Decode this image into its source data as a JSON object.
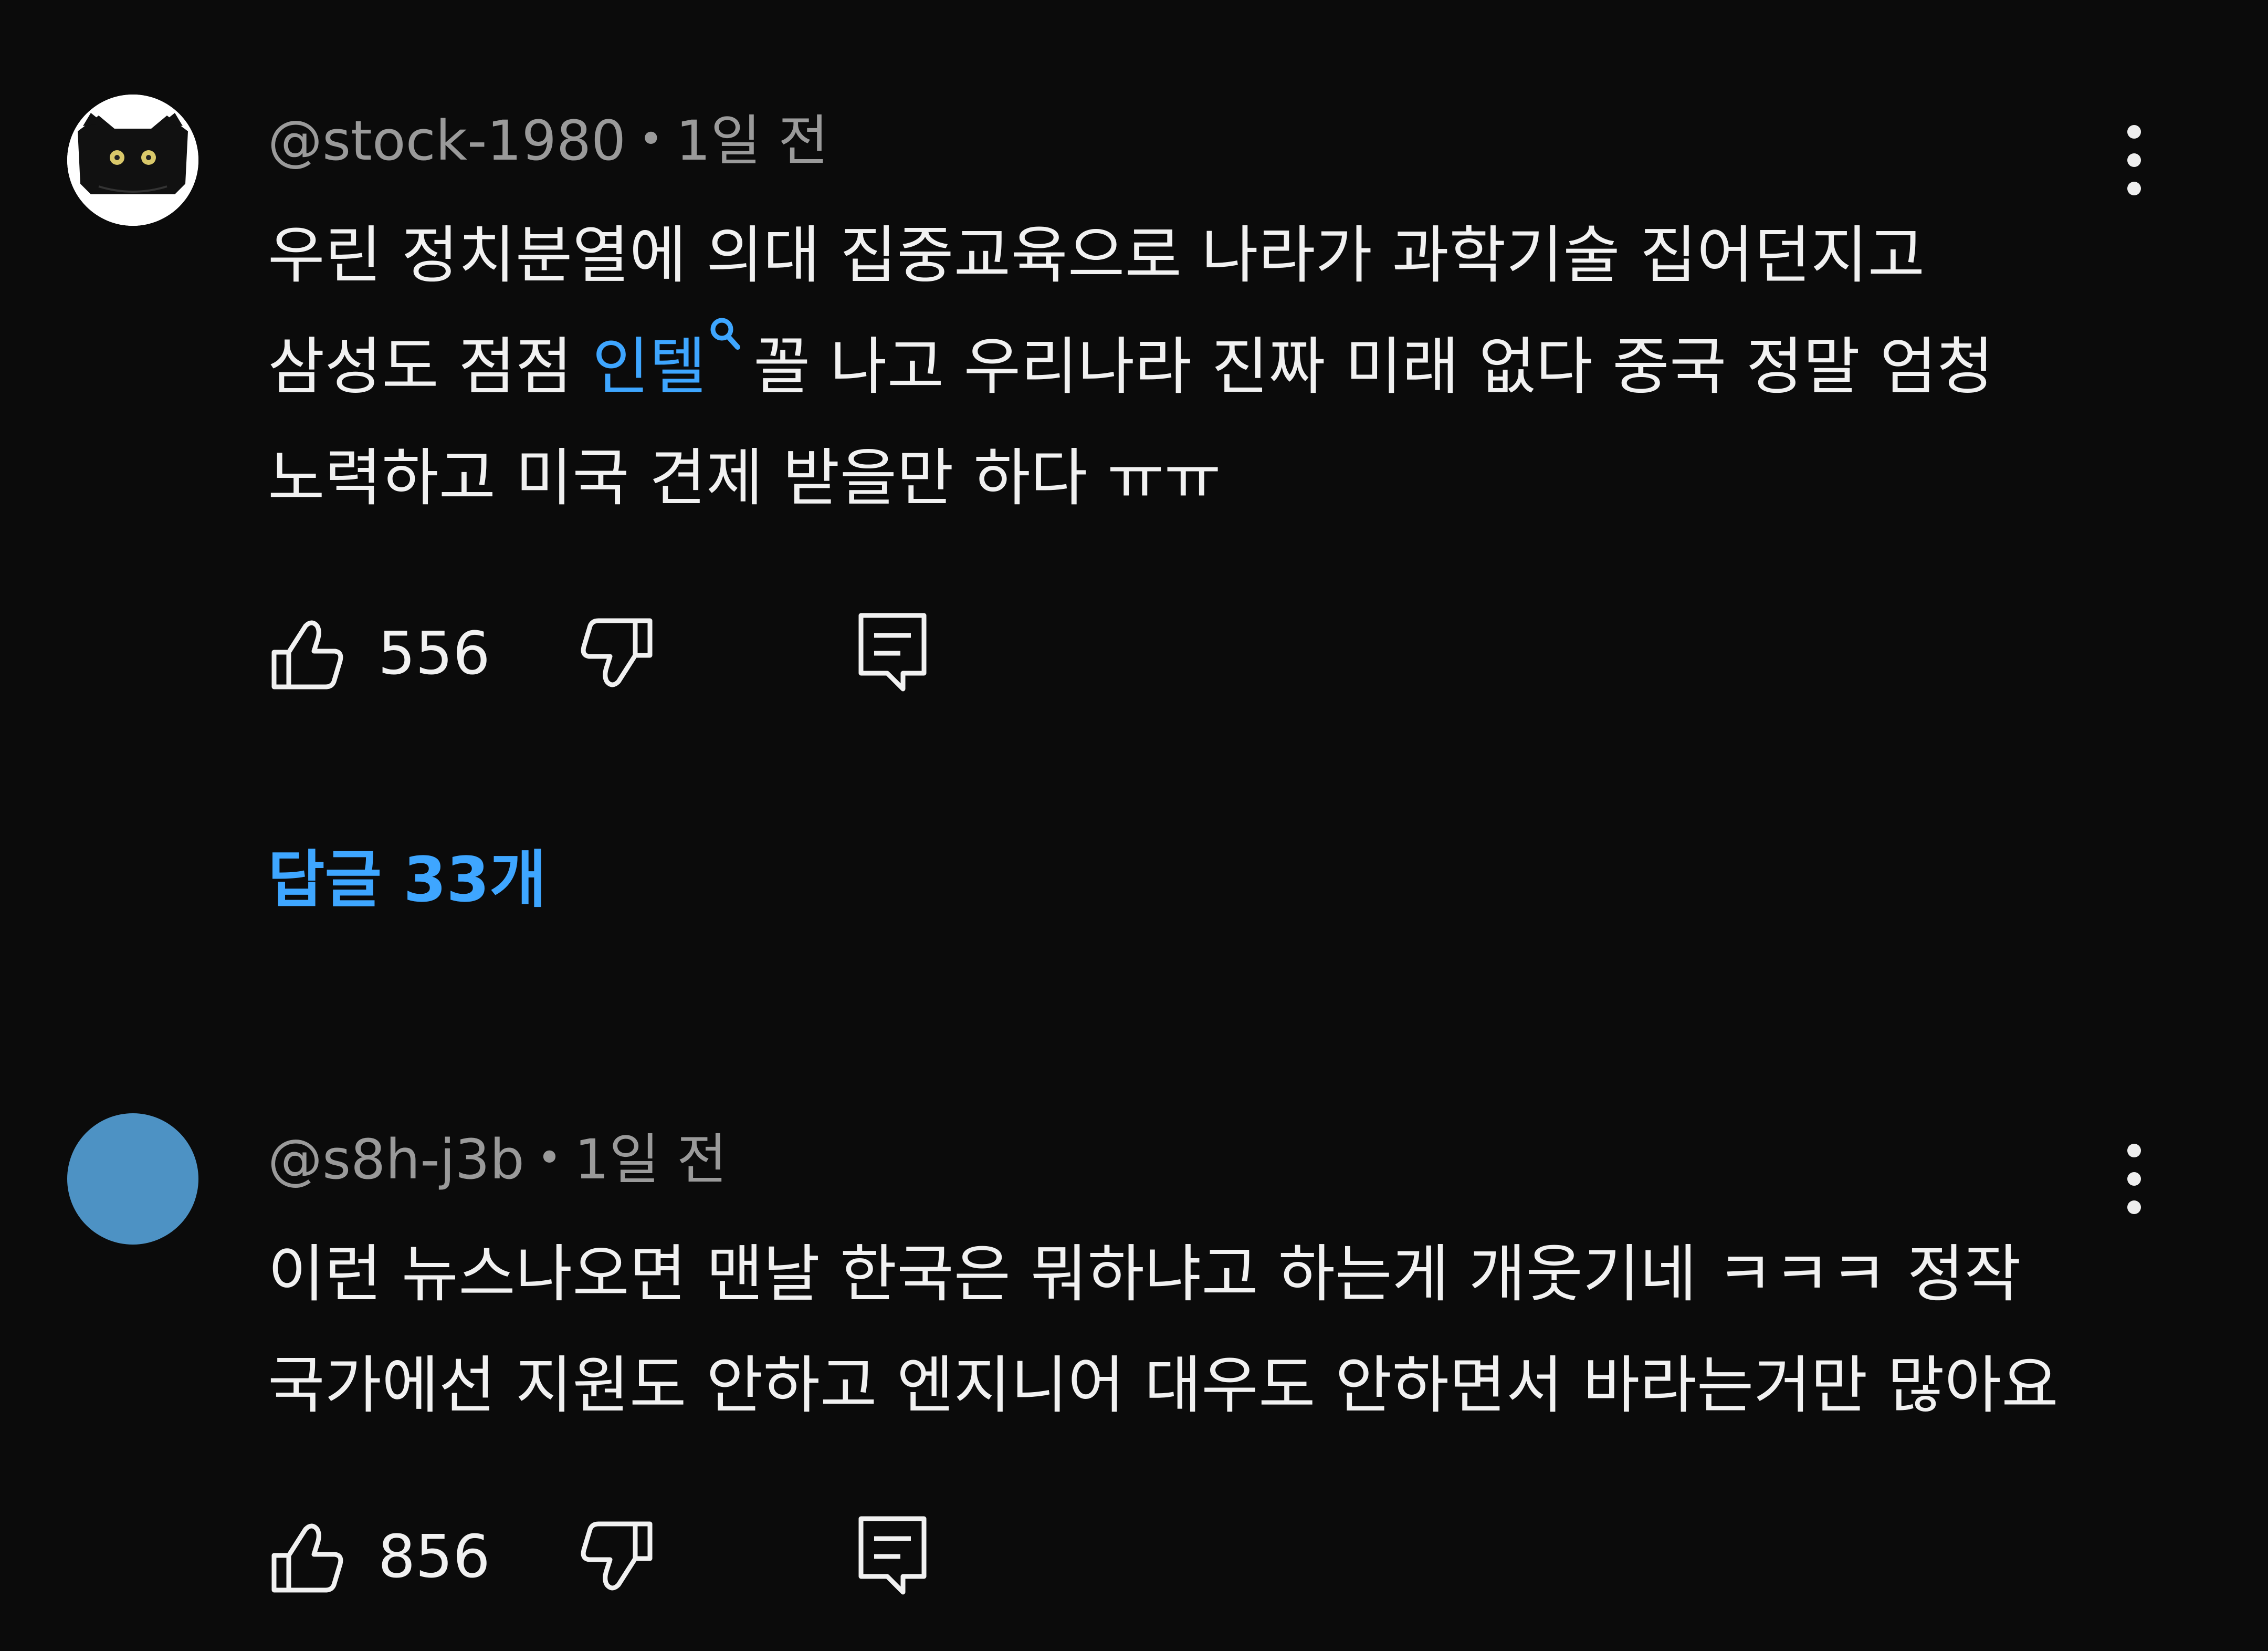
{
  "comments": [
    {
      "author": "@stock-1980",
      "time": "1일 전",
      "lines": [
        "우린 정치분열에 의대 집중교육으로 나라가 과학기술 집어던지고",
        "삼성도 점점",
        "꼴 나고 우리나라 진짜 미래 없다 중국 정말 엄청",
        "노력하고 미국 견제 받을만 하다 ㅠㅠ"
      ],
      "link_text": "인텔",
      "likes": "556",
      "replies_label": "답글 33개"
    },
    {
      "author": "@s8h-j3b",
      "time": "1일 전",
      "lines": [
        "이런 뉴스나오면 맨날 한국은 뭐하냐고 하는게 개웃기네 ㅋㅋㅋ 정작",
        "국가에선 지원도 안하고 엔지니어 대우도 안하면서 바라는거만 많아요"
      ],
      "likes": "856",
      "avatar_color": "#4d92c4"
    }
  ],
  "meta_separator": "•",
  "icons": {
    "like": "thumb-up-icon",
    "dislike": "thumb-down-icon",
    "reply": "reply-comment-icon",
    "more": "more-vert-icon",
    "link": "search-icon"
  },
  "colors": {
    "background": "#0b0b0b",
    "text": "#f1f1f1",
    "meta": "#9a9a9a",
    "link": "#3ea6ff"
  }
}
